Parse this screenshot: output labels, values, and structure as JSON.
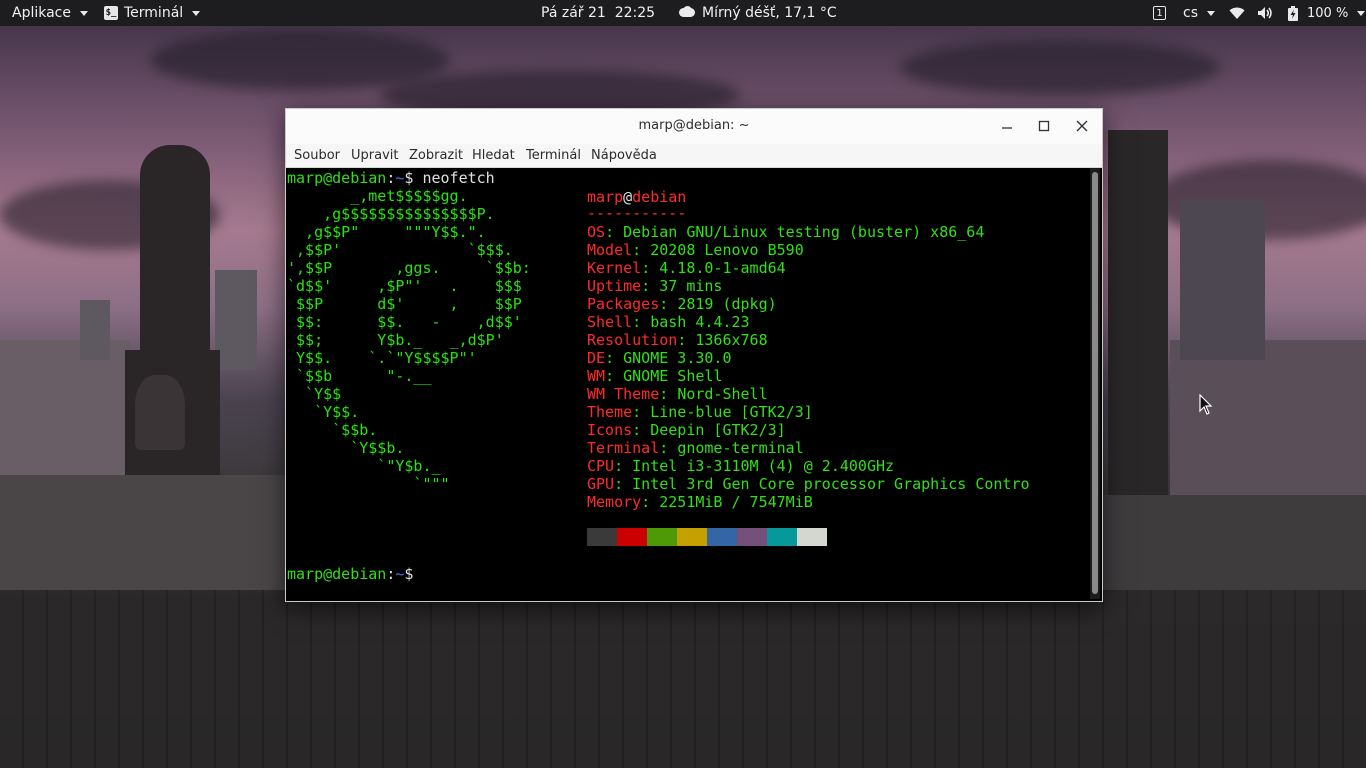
{
  "topbar": {
    "apps_label": "Aplikace",
    "terminal_label": "Terminál",
    "terminal_icon_glyph": "$_",
    "clock": "Pá zář 21  22:25",
    "weather": "Mírný déšť, 17,1 °C",
    "workspace": "1",
    "language": "cs",
    "battery": "100 %"
  },
  "window": {
    "title": "marp@debian: ~",
    "menu": [
      "Soubor",
      "Upravit",
      "Zobrazit",
      "Hledat",
      "Terminál",
      "Nápověda"
    ]
  },
  "terminal": {
    "user": "marp",
    "at": "@",
    "host": "debian",
    "colon": ":",
    "path": "~",
    "prompt_symbol": "$",
    "command": " neofetch",
    "logo_lines": [
      "       _,met$$$$$gg.",
      "    ,g$$$$$$$$$$$$$$$P.",
      "  ,g$$P\"     \"\"\"Y$$.\".",
      " ,$$P'              `$$$.",
      "',$$P       ,ggs.     `$$b:",
      "`d$$'     ,$P\"'   .    $$$",
      " $$P      d$'     ,    $$P",
      " $$:      $$.   -    ,d$$'",
      " $$;      Y$b._   _,d$P'",
      " Y$$.    `.`\"Y$$$$P\"'",
      " `$$b      \"-.__",
      "  `Y$$",
      "   `Y$$.",
      "     `$$b.",
      "       `Y$$b.",
      "          `\"Y$b._",
      "              `\"\"\""
    ],
    "info_user": "marp",
    "info_at": "@",
    "info_host": "debian",
    "separator": "-----------",
    "info": [
      {
        "key": "OS",
        "value": "Debian GNU/Linux testing (buster) x86_64"
      },
      {
        "key": "Model",
        "value": "20208 Lenovo B590"
      },
      {
        "key": "Kernel",
        "value": "4.18.0-1-amd64"
      },
      {
        "key": "Uptime",
        "value": "37 mins"
      },
      {
        "key": "Packages",
        "value": "2819 (dpkg)"
      },
      {
        "key": "Shell",
        "value": "bash 4.4.23"
      },
      {
        "key": "Resolution",
        "value": "1366x768"
      },
      {
        "key": "DE",
        "value": "GNOME 3.30.0"
      },
      {
        "key": "WM",
        "value": "GNOME Shell"
      },
      {
        "key": "WM Theme",
        "value": "Nord-Shell"
      },
      {
        "key": "Theme",
        "value": "Line-blue [GTK2/3]"
      },
      {
        "key": "Icons",
        "value": "Deepin [GTK2/3]"
      },
      {
        "key": "Terminal",
        "value": "gnome-terminal"
      },
      {
        "key": "CPU",
        "value": "Intel i3-3110M (4) @ 2.400GHz"
      },
      {
        "key": "GPU",
        "value": "Intel 3rd Gen Core processor Graphics Contro"
      },
      {
        "key": "Memory",
        "value": "2251MiB / 7547MiB"
      }
    ],
    "palette": [
      "#3a3a3a",
      "#cc0000",
      "#4e9a06",
      "#c4a000",
      "#3465a4",
      "#75507b",
      "#06989a",
      "#d3d7cf"
    ]
  }
}
